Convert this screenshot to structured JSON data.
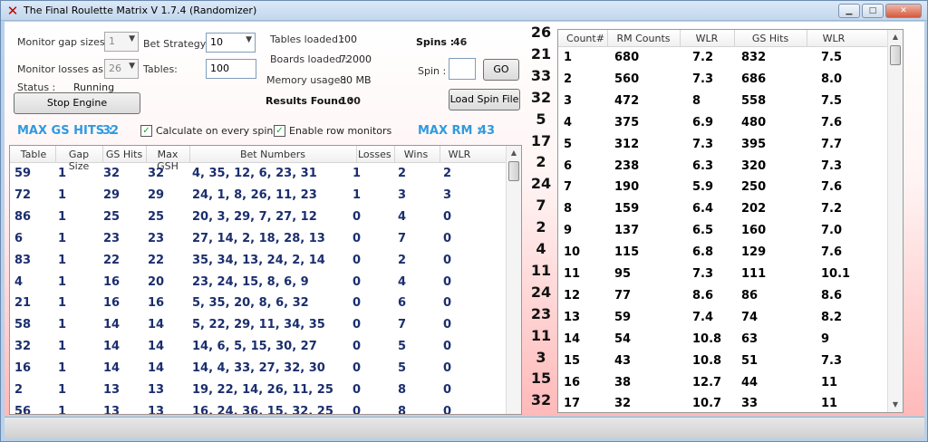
{
  "window": {
    "title": "The Final Roulette Matrix V 1.7.4 (Randomizer)",
    "min_label": "▁",
    "max_label": "□",
    "close_label": "✕"
  },
  "controls": {
    "monitor_gap_label": "Monitor gap sizes :",
    "monitor_gap_value": "1",
    "monitor_losses_label": "Monitor losses as :",
    "monitor_losses_value": "26",
    "status_label": "Status :",
    "status_value": "Running",
    "stop_button": "Stop Engine",
    "bet_strategy_label": "Bet Strategy :",
    "bet_strategy_value": "10",
    "tables_label": "Tables:",
    "tables_value": "100",
    "tables_loaded_label": "Tables loaded :",
    "tables_loaded_value": "100",
    "boards_loaded_label": "Boards loaded :",
    "boards_loaded_value": "72000",
    "memory_label": "Memory usage :",
    "memory_value": "80 MB",
    "results_label": "Results Found :",
    "results_value": "100",
    "spins_label": "Spins :",
    "spins_value": "46",
    "spin_label": "Spin :",
    "spin_input": "",
    "go_button": "GO",
    "load_button": "Load Spin File",
    "max_gs_hits_label": "MAX GS HITS :",
    "max_gs_hits_value": "32",
    "calc_every_spin": "Calculate on every spin",
    "enable_row_monitors": "Enable row monitors",
    "max_rm_label": "MAX RM :",
    "max_rm_value": "43",
    "check_mark": "✓"
  },
  "left_table": {
    "columns": [
      "Table",
      "Gap Size",
      "GS Hits",
      "Max GSH",
      "Bet Numbers",
      "Losses",
      "Wins",
      "WLR"
    ],
    "rows": [
      [
        "59",
        "1",
        "32",
        "32",
        "4, 35, 12, 6, 23, 31",
        "1",
        "2",
        "2"
      ],
      [
        "72",
        "1",
        "29",
        "29",
        "24, 1, 8, 26, 11, 23",
        "1",
        "3",
        "3"
      ],
      [
        "86",
        "1",
        "25",
        "25",
        "20, 3, 29, 7, 27, 12",
        "0",
        "4",
        "0"
      ],
      [
        "6",
        "1",
        "23",
        "23",
        "27, 14, 2, 18, 28, 13",
        "0",
        "7",
        "0"
      ],
      [
        "83",
        "1",
        "22",
        "22",
        "35, 34, 13, 24, 2, 14",
        "0",
        "2",
        "0"
      ],
      [
        "4",
        "1",
        "16",
        "20",
        "23, 24, 15, 8, 6, 9",
        "0",
        "4",
        "0"
      ],
      [
        "21",
        "1",
        "16",
        "16",
        "5, 35, 20, 8, 6, 32",
        "0",
        "6",
        "0"
      ],
      [
        "58",
        "1",
        "14",
        "14",
        "5, 22, 29, 11, 34, 35",
        "0",
        "7",
        "0"
      ],
      [
        "32",
        "1",
        "14",
        "14",
        "14, 6, 5, 15, 30, 27",
        "0",
        "5",
        "0"
      ],
      [
        "16",
        "1",
        "14",
        "14",
        "14, 4, 33, 27, 32, 30",
        "0",
        "5",
        "0"
      ],
      [
        "2",
        "1",
        "13",
        "13",
        "19, 22, 14, 26, 11, 25",
        "0",
        "8",
        "0"
      ],
      [
        "56",
        "1",
        "13",
        "13",
        "16, 24, 36, 15, 32, 25",
        "0",
        "8",
        "0"
      ]
    ]
  },
  "spin_history": [
    "26",
    "21",
    "33",
    "32",
    "5",
    "17",
    "2",
    "24",
    "7",
    "2",
    "4",
    "11",
    "24",
    "23",
    "11",
    "3",
    "15",
    "32"
  ],
  "right_table": {
    "columns": [
      "Count#",
      "RM Counts",
      "WLR",
      "GS Hits",
      "WLR"
    ],
    "rows": [
      [
        "1",
        "680",
        "7.2",
        "832",
        "7.5"
      ],
      [
        "2",
        "560",
        "7.3",
        "686",
        "8.0"
      ],
      [
        "3",
        "472",
        "8",
        "558",
        "7.5"
      ],
      [
        "4",
        "375",
        "6.9",
        "480",
        "7.6"
      ],
      [
        "5",
        "312",
        "7.3",
        "395",
        "7.7"
      ],
      [
        "6",
        "238",
        "6.3",
        "320",
        "7.3"
      ],
      [
        "7",
        "190",
        "5.9",
        "250",
        "7.6"
      ],
      [
        "8",
        "159",
        "6.4",
        "202",
        "7.2"
      ],
      [
        "9",
        "137",
        "6.5",
        "160",
        "7.0"
      ],
      [
        "10",
        "115",
        "6.8",
        "129",
        "7.6"
      ],
      [
        "11",
        "95",
        "7.3",
        "111",
        "10.1"
      ],
      [
        "12",
        "77",
        "8.6",
        "86",
        "8.6"
      ],
      [
        "13",
        "59",
        "7.4",
        "74",
        "8.2"
      ],
      [
        "14",
        "54",
        "10.8",
        "63",
        "9"
      ],
      [
        "15",
        "43",
        "10.8",
        "51",
        "7.3"
      ],
      [
        "16",
        "38",
        "12.7",
        "44",
        "11"
      ],
      [
        "17",
        "32",
        "10.7",
        "33",
        "11"
      ]
    ]
  },
  "colors": {
    "accent": "#2e9be0",
    "cell_text": "#1b2e6e",
    "client_gradient_end": "#ffb9b9"
  }
}
